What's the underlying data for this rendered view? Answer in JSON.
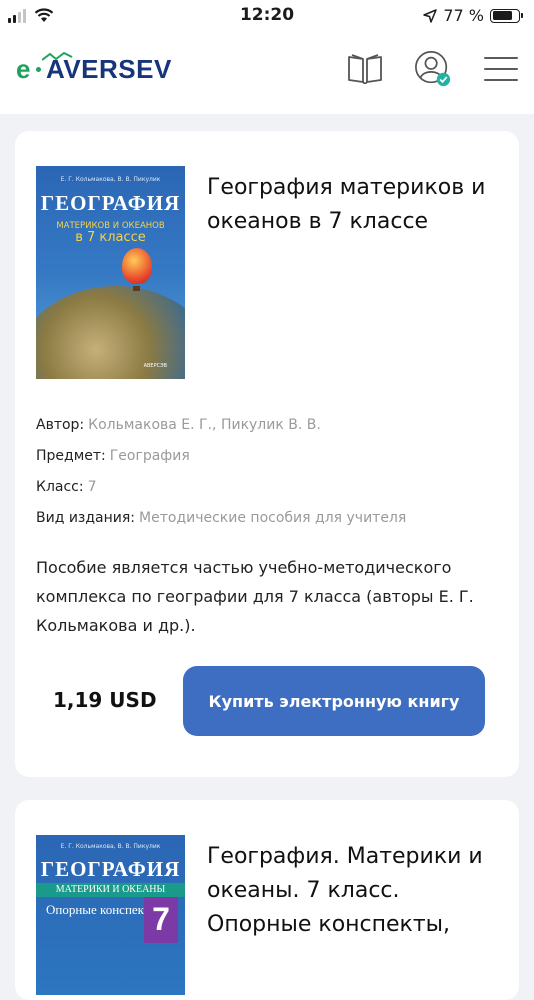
{
  "status_bar": {
    "time": "12:20",
    "battery_text": "77 %",
    "battery_level": 0.77
  },
  "header": {
    "logo_prefix": "e",
    "logo_brand": "AVERSEV",
    "icons": [
      "book-icon",
      "user-verified-icon",
      "menu-icon"
    ]
  },
  "colors": {
    "accent": "#3e6ec1",
    "brand_blue": "#16357b",
    "brand_green": "#1fa35c",
    "background": "#f1f2f5"
  },
  "books": [
    {
      "title": "География материков и океанов в 7 классе",
      "cover": {
        "authors": "Е. Г. Кольмакова, В. В. Пикулик",
        "title": "ГЕОГРАФИЯ",
        "subtitle_line1": "МАТЕРИКОВ И ОКЕАНОВ",
        "subtitle_line2": "в 7 классе",
        "publisher": "АВЕРСЭВ"
      },
      "meta": [
        {
          "label": "Автор:",
          "value": "Кольмакова Е. Г., Пикулик В. В."
        },
        {
          "label": "Предмет:",
          "value": "География"
        },
        {
          "label": "Класс:",
          "value": "7"
        },
        {
          "label": "Вид издания:",
          "value": "Методические пособия для учителя"
        }
      ],
      "description": "Пособие является частью учебно-методического комплекса по географии для 7 класса (авторы Е. Г. Кольмакова и др.).",
      "price": "1,19 USD",
      "buy_label": "Купить электронную книгу"
    },
    {
      "title": "География. Материки и океаны. 7 класс. Опорные конспекты,",
      "cover": {
        "authors": "Е. Г. Кольмакова, В. В. Пикулик",
        "title": "ГЕОГРАФИЯ",
        "band": "МАТЕРИКИ И ОКЕАНЫ",
        "subtitle": "Опорные конспекты,",
        "grade": "7"
      }
    }
  ]
}
